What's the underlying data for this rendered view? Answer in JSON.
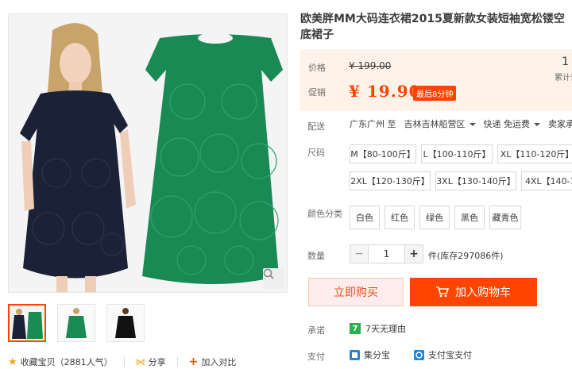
{
  "product": {
    "title": "欧美胖MM大码连衣裙2015夏新款女装短袖宽松镂空底裙子"
  },
  "gallery": {
    "thumbnails": [
      "thumb-navy-and-green",
      "thumb-green",
      "thumb-black"
    ],
    "active_thumb": 0
  },
  "actions": {
    "favorite_label": "收藏宝贝（2881人气）",
    "share_label": "分享",
    "compare_label": "加入对比"
  },
  "price": {
    "label": "价格",
    "original": "¥ 199.00",
    "promo_label": "促销",
    "promo": "¥ 19.90",
    "promo_badge": "最后8分钟",
    "sales_count": "1",
    "sales_label": "累计评"
  },
  "delivery": {
    "label": "配送",
    "from": "广东广州 至",
    "to": "吉林吉林船营区",
    "shipping": "快递 免运费",
    "seller_promise": "卖家承"
  },
  "size": {
    "label": "尺码",
    "options": [
      "M【80-100斤】",
      "L【100-110斤】",
      "XL【110-120斤】",
      "2XL【120-130斤】",
      "3XL【130-140斤】",
      "4XL【140-1"
    ]
  },
  "color": {
    "label": "颜色分类",
    "options": [
      "白色",
      "红色",
      "绿色",
      "黑色",
      "藏青色"
    ]
  },
  "quantity": {
    "label": "数量",
    "value": "1",
    "minus": "−",
    "plus": "+",
    "stock": "件(库存297086件)"
  },
  "buttons": {
    "buy_now": "立即购买",
    "add_cart": "加入购物车"
  },
  "promise": {
    "label": "承诺",
    "icon_text": "7",
    "text": "7天无理由"
  },
  "payment": {
    "label": "支付",
    "method1": "集分宝",
    "method2": "支付宝支付"
  },
  "colors": {
    "accent": "#ff4400",
    "price_bg": "#fff2e8",
    "dress_green": "#1a8a55",
    "dress_navy": "#1b2136"
  }
}
